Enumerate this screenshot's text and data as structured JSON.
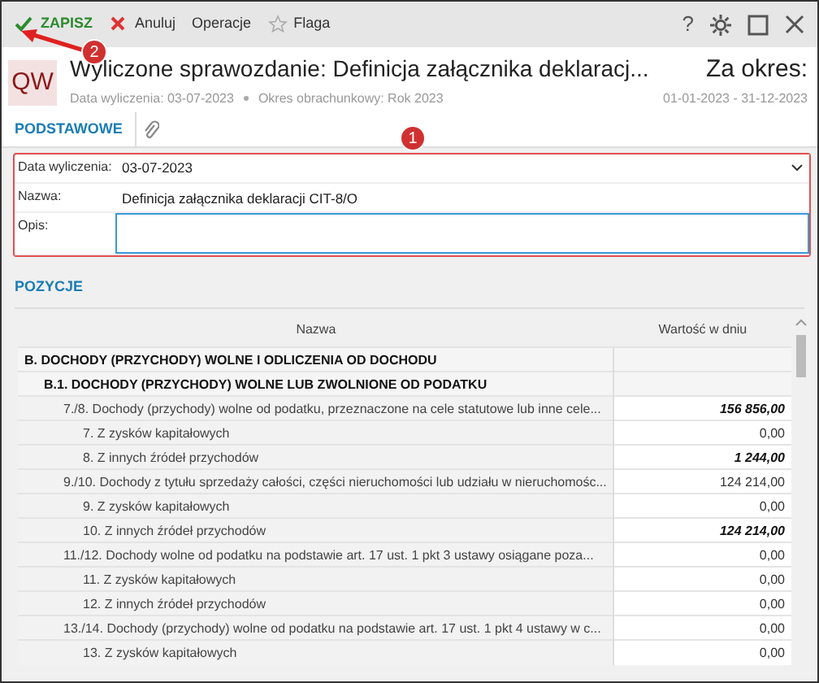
{
  "toolbar": {
    "buttons": [
      {
        "kind": "save",
        "label": "ZAPISZ"
      },
      {
        "kind": "cancel",
        "label": "Anuluj"
      },
      {
        "kind": "plain",
        "label": "Operacje"
      },
      {
        "kind": "flag",
        "label": "Flaga"
      }
    ],
    "help": "?"
  },
  "header": {
    "avatar": "QW",
    "title": "Wyliczone sprawozdanie: Definicja załącznika deklaracj...",
    "meta": [
      "Data wyliczenia: 03-07-2023",
      "Okres obrachunkowy: Rok 2023"
    ],
    "period_label": "Za okres:",
    "period": "01-01-2023 - 31-12-2023"
  },
  "tabs": [
    {
      "label": "PODSTAWOWE",
      "selected": true
    }
  ],
  "form": [
    {
      "kind": "select",
      "label": "Data wyliczenia:",
      "value": "03-07-2023"
    },
    {
      "kind": "text",
      "label": "Nazwa:",
      "value": "Definicja załącznika deklaracji CIT-8/O"
    },
    {
      "kind": "textarea",
      "label": "Opis:",
      "focused": true
    }
  ],
  "section_title": "POZYCJE",
  "table": {
    "columns": [
      "Nazwa",
      "Wartość w dniu"
    ],
    "rows": [
      {
        "kind": "section",
        "name": "B. DOCHODY (PRZYCHODY) WOLNE I ODLICZENIA OD DOCHODU",
        "children": [
          {
            "kind": "section",
            "name": "B.1. DOCHODY (PRZYCHODY) WOLNE LUB ZWOLNIONE OD PODATKU",
            "children": [
              {
                "kind": "item",
                "name": "7./8. Dochody (przychody) wolne od podatku, przeznaczone na cele statutowe lub inne cele...",
                "value": "156 856,00",
                "emphasis": true,
                "children": [
                  {
                    "kind": "item",
                    "name": "7. Z zysków kapitałowych",
                    "value": "0,00",
                    "emphasis": false
                  },
                  {
                    "kind": "item",
                    "name": "8. Z innych źródeł przychodów",
                    "value": "1 244,00",
                    "emphasis": true
                  }
                ]
              },
              {
                "kind": "item",
                "name": "9./10. Dochody z tytułu sprzedaży całości, części nieruchomości lub udziału w nieruchomośc...",
                "value": "124 214,00",
                "emphasis": false,
                "children": [
                  {
                    "kind": "item",
                    "name": "9. Z zysków kapitałowych",
                    "value": "0,00",
                    "emphasis": false
                  },
                  {
                    "kind": "item",
                    "name": "10. Z innych źródeł przychodów",
                    "value": "124 214,00",
                    "emphasis": true
                  }
                ]
              },
              {
                "kind": "item",
                "name": "11./12. Dochody wolne od podatku na podstawie art. 17 ust. 1 pkt 3 ustawy osiągane poza...",
                "value": "0,00",
                "emphasis": false,
                "children": [
                  {
                    "kind": "item",
                    "name": "11. Z zysków kapitałowych",
                    "value": "0,00",
                    "emphasis": false
                  },
                  {
                    "kind": "item",
                    "name": "12. Z innych źródeł przychodów",
                    "value": "0,00",
                    "emphasis": false
                  }
                ]
              },
              {
                "kind": "item",
                "name": "13./14. Dochody (przychody) wolne od podatku na podstawie art. 17 ust. 1 pkt 4 ustawy w c...",
                "value": "0,00",
                "emphasis": false,
                "children": [
                  {
                    "kind": "item",
                    "name": "13. Z zysków kapitałowych",
                    "value": "0,00",
                    "emphasis": false
                  }
                ]
              }
            ]
          }
        ]
      }
    ]
  },
  "callouts": [
    {
      "label": "2"
    },
    {
      "label": "1"
    }
  ]
}
